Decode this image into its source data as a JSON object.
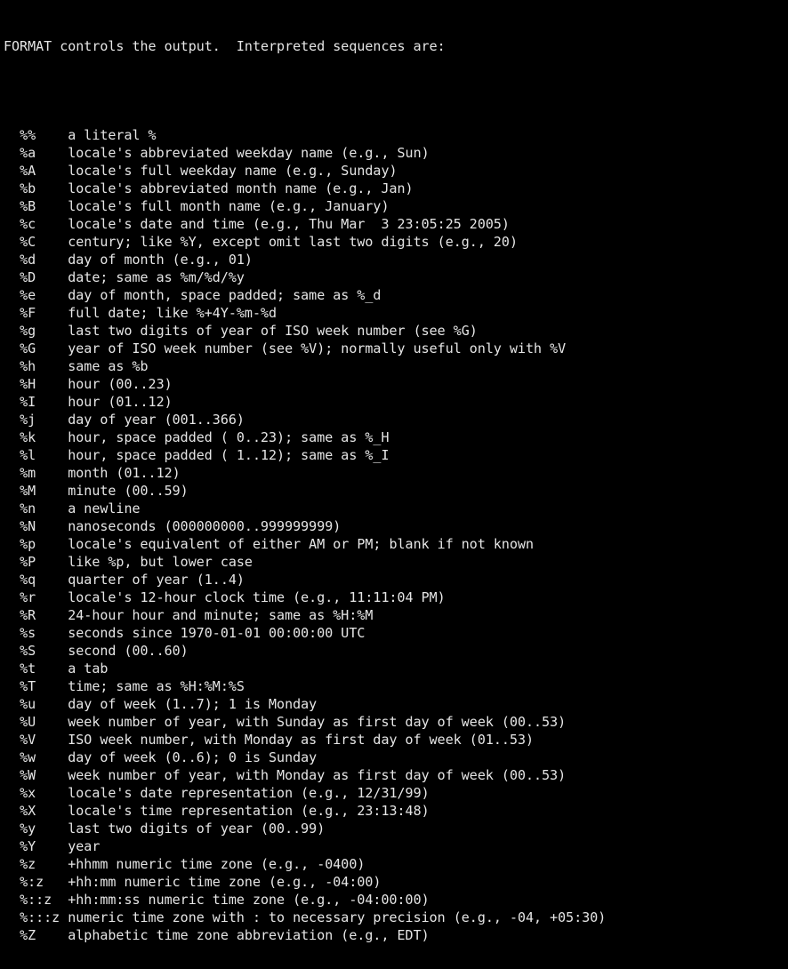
{
  "header": "FORMAT controls the output.  Interpreted sequences are:",
  "blank": "",
  "specs": [
    {
      "code": "%%",
      "desc": "a literal %"
    },
    {
      "code": "%a",
      "desc": "locale's abbreviated weekday name (e.g., Sun)"
    },
    {
      "code": "%A",
      "desc": "locale's full weekday name (e.g., Sunday)"
    },
    {
      "code": "%b",
      "desc": "locale's abbreviated month name (e.g., Jan)"
    },
    {
      "code": "%B",
      "desc": "locale's full month name (e.g., January)"
    },
    {
      "code": "%c",
      "desc": "locale's date and time (e.g., Thu Mar  3 23:05:25 2005)"
    },
    {
      "code": "%C",
      "desc": "century; like %Y, except omit last two digits (e.g., 20)"
    },
    {
      "code": "%d",
      "desc": "day of month (e.g., 01)"
    },
    {
      "code": "%D",
      "desc": "date; same as %m/%d/%y"
    },
    {
      "code": "%e",
      "desc": "day of month, space padded; same as %_d"
    },
    {
      "code": "%F",
      "desc": "full date; like %+4Y-%m-%d"
    },
    {
      "code": "%g",
      "desc": "last two digits of year of ISO week number (see %G)"
    },
    {
      "code": "%G",
      "desc": "year of ISO week number (see %V); normally useful only with %V"
    },
    {
      "code": "%h",
      "desc": "same as %b"
    },
    {
      "code": "%H",
      "desc": "hour (00..23)"
    },
    {
      "code": "%I",
      "desc": "hour (01..12)"
    },
    {
      "code": "%j",
      "desc": "day of year (001..366)"
    },
    {
      "code": "%k",
      "desc": "hour, space padded ( 0..23); same as %_H"
    },
    {
      "code": "%l",
      "desc": "hour, space padded ( 1..12); same as %_I"
    },
    {
      "code": "%m",
      "desc": "month (01..12)"
    },
    {
      "code": "%M",
      "desc": "minute (00..59)"
    },
    {
      "code": "%n",
      "desc": "a newline"
    },
    {
      "code": "%N",
      "desc": "nanoseconds (000000000..999999999)"
    },
    {
      "code": "%p",
      "desc": "locale's equivalent of either AM or PM; blank if not known"
    },
    {
      "code": "%P",
      "desc": "like %p, but lower case"
    },
    {
      "code": "%q",
      "desc": "quarter of year (1..4)"
    },
    {
      "code": "%r",
      "desc": "locale's 12-hour clock time (e.g., 11:11:04 PM)"
    },
    {
      "code": "%R",
      "desc": "24-hour hour and minute; same as %H:%M"
    },
    {
      "code": "%s",
      "desc": "seconds since 1970-01-01 00:00:00 UTC"
    },
    {
      "code": "%S",
      "desc": "second (00..60)"
    },
    {
      "code": "%t",
      "desc": "a tab"
    },
    {
      "code": "%T",
      "desc": "time; same as %H:%M:%S"
    },
    {
      "code": "%u",
      "desc": "day of week (1..7); 1 is Monday"
    },
    {
      "code": "%U",
      "desc": "week number of year, with Sunday as first day of week (00..53)"
    },
    {
      "code": "%V",
      "desc": "ISO week number, with Monday as first day of week (01..53)"
    },
    {
      "code": "%w",
      "desc": "day of week (0..6); 0 is Sunday"
    },
    {
      "code": "%W",
      "desc": "week number of year, with Monday as first day of week (00..53)"
    },
    {
      "code": "%x",
      "desc": "locale's date representation (e.g., 12/31/99)"
    },
    {
      "code": "%X",
      "desc": "locale's time representation (e.g., 23:13:48)"
    },
    {
      "code": "%y",
      "desc": "last two digits of year (00..99)"
    },
    {
      "code": "%Y",
      "desc": "year"
    },
    {
      "code": "%z",
      "desc": "+hhmm numeric time zone (e.g., -0400)"
    },
    {
      "code": "%:z",
      "desc": "+hh:mm numeric time zone (e.g., -04:00)"
    },
    {
      "code": "%::z",
      "desc": "+hh:mm:ss numeric time zone (e.g., -04:00:00)"
    },
    {
      "code": "%:::z",
      "desc": "numeric time zone with : to necessary precision (e.g., -04, +05:30)"
    },
    {
      "code": "%Z",
      "desc": "alphabetic time zone abbreviation (e.g., EDT)"
    }
  ],
  "layout": {
    "indent": 2,
    "codeWidth": 6
  }
}
